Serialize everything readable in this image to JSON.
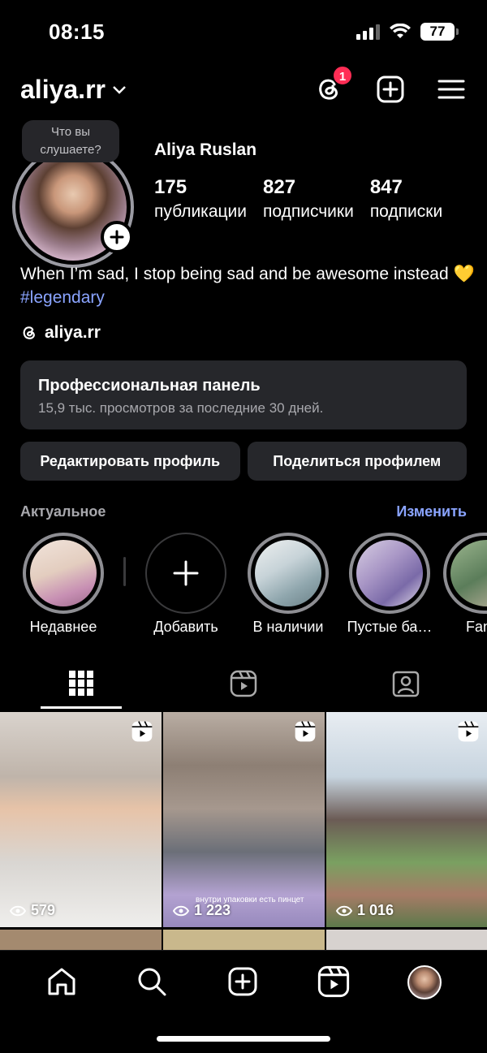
{
  "status": {
    "time": "08:15",
    "battery": "77"
  },
  "header": {
    "username": "aliya.rr",
    "threads_badge": "1"
  },
  "profile": {
    "note": "Что вы слушаете?",
    "full_name": "Aliya Ruslan",
    "stats": [
      {
        "num": "175",
        "label": "публикации"
      },
      {
        "num": "827",
        "label": "подписчики"
      },
      {
        "num": "847",
        "label": "подписки"
      }
    ],
    "bio_text": "When I’m sad, I stop being sad and be awesome instead 💛",
    "bio_hashtag": "#legendary",
    "threads_handle": "aliya.rr"
  },
  "pro_panel": {
    "title": "Профессиональная панель",
    "subtitle": "15,9 тыс. просмотров за последние 30 дней."
  },
  "actions": {
    "edit": "Редактировать профиль",
    "share": "Поделиться профилем"
  },
  "highlights_section": {
    "title": "Актуальное",
    "edit": "Изменить"
  },
  "highlights": [
    {
      "label": "Недавнее",
      "color": "#e9d7cf"
    },
    {
      "label": "Добавить"
    },
    {
      "label": "В наличии",
      "color": "#b9c6cc"
    },
    {
      "label": "Пустые ба…",
      "color": "#a59ac4"
    },
    {
      "label": "Fan",
      "color": "#5b7d5a"
    }
  ],
  "posts": [
    {
      "views": "579",
      "color": "#cfc4bd"
    },
    {
      "views": "1 223",
      "color": "#9a8f86",
      "caption": "внутри упаковки есть пинцет"
    },
    {
      "views": "1 016",
      "color": "#c9d4de"
    }
  ],
  "colors": {
    "accent": "#8aa4ff",
    "badge": "#ff2d55",
    "panel": "#26272b"
  }
}
